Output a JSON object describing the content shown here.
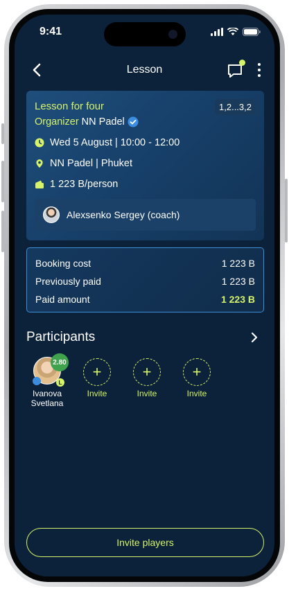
{
  "status": {
    "time": "9:41"
  },
  "nav": {
    "title": "Lesson"
  },
  "lesson": {
    "title": "Lesson for four",
    "level": "1,2...3,2",
    "organizer_label": "Organizer",
    "organizer_name": "NN Padel",
    "datetime": "Wed 5 August | 10:00 - 12:00",
    "location": "NN Padel | Phuket",
    "price": "1 223 B/person",
    "coach": "Alexsenko Sergey (coach)"
  },
  "cost": {
    "rows": [
      {
        "label": "Booking cost",
        "value": "1 223 B"
      },
      {
        "label": "Previously paid",
        "value": "1 223 B"
      },
      {
        "label": "Paid amount",
        "value": "1 223 B"
      }
    ]
  },
  "participants": {
    "title": "Participants",
    "players": [
      {
        "first_name": "Ivanova",
        "last_name": "Svetlana",
        "rating": "2.80",
        "level_letter": "L"
      }
    ],
    "invite_label": "Invite",
    "invite_slots": 3
  },
  "footer": {
    "invite_players_label": "Invite players"
  },
  "colors": {
    "accent": "#d7f36a",
    "background": "#0c223a",
    "card": "#17406a",
    "border": "#3e8fd6",
    "rating": "#3fa34d"
  }
}
